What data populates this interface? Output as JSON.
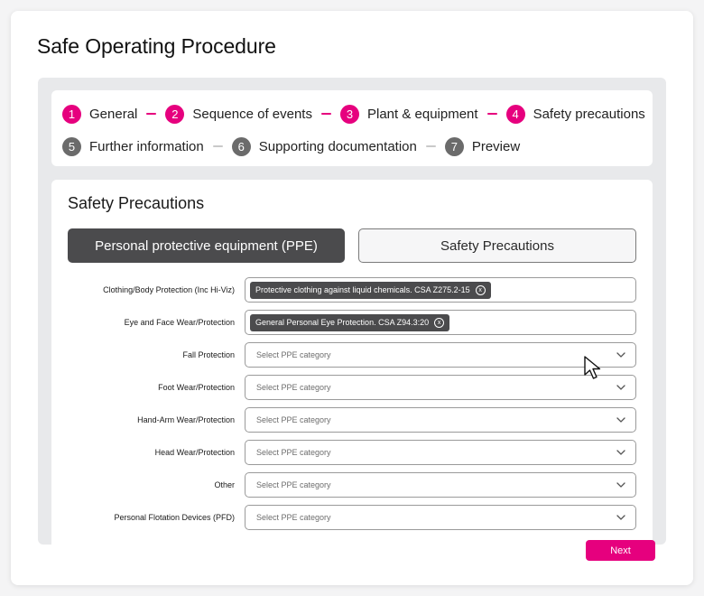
{
  "page": {
    "title": "Safe Operating Procedure"
  },
  "stepper": {
    "steps": [
      {
        "number": "1",
        "label": "General",
        "state": "active"
      },
      {
        "number": "2",
        "label": "Sequence of events",
        "state": "active"
      },
      {
        "number": "3",
        "label": "Plant & equipment",
        "state": "active"
      },
      {
        "number": "4",
        "label": "Safety precautions",
        "state": "active"
      },
      {
        "number": "5",
        "label": "Further information",
        "state": "inactive"
      },
      {
        "number": "6",
        "label": "Supporting documentation",
        "state": "inactive"
      },
      {
        "number": "7",
        "label": "Preview",
        "state": "inactive"
      }
    ]
  },
  "section": {
    "title": "Safety Precautions",
    "tabs": [
      {
        "label": "Personal protective equipment (PPE)",
        "selected": true
      },
      {
        "label": "Safety Precautions",
        "selected": false
      }
    ]
  },
  "ppe_fields": [
    {
      "label": "Clothing/Body Protection (Inc Hi-Viz)",
      "chips": [
        "Protective clothing against liquid chemicals. CSA Z275.2-15"
      ],
      "placeholder": ""
    },
    {
      "label": "Eye and Face Wear/Protection",
      "chips": [
        "General Personal Eye Protection. CSA Z94.3:20"
      ],
      "placeholder": ""
    },
    {
      "label": "Fall Protection",
      "chips": [],
      "placeholder": "Select PPE category"
    },
    {
      "label": "Foot Wear/Protection",
      "chips": [],
      "placeholder": "Select PPE category"
    },
    {
      "label": "Hand-Arm Wear/Protection",
      "chips": [],
      "placeholder": "Select PPE category"
    },
    {
      "label": "Head Wear/Protection",
      "chips": [],
      "placeholder": "Select PPE category"
    },
    {
      "label": "Other",
      "chips": [],
      "placeholder": "Select PPE category"
    },
    {
      "label": "Personal Flotation Devices (PFD)",
      "chips": [],
      "placeholder": "Select PPE category"
    }
  ],
  "chip_remove_glyph": "x",
  "footer": {
    "next_label": "Next"
  },
  "colors": {
    "accent": "#e6007e",
    "inactive_step": "#6b6b6b",
    "dark_surface": "#4b4b4d",
    "panel_bg": "#e8e9eb"
  }
}
